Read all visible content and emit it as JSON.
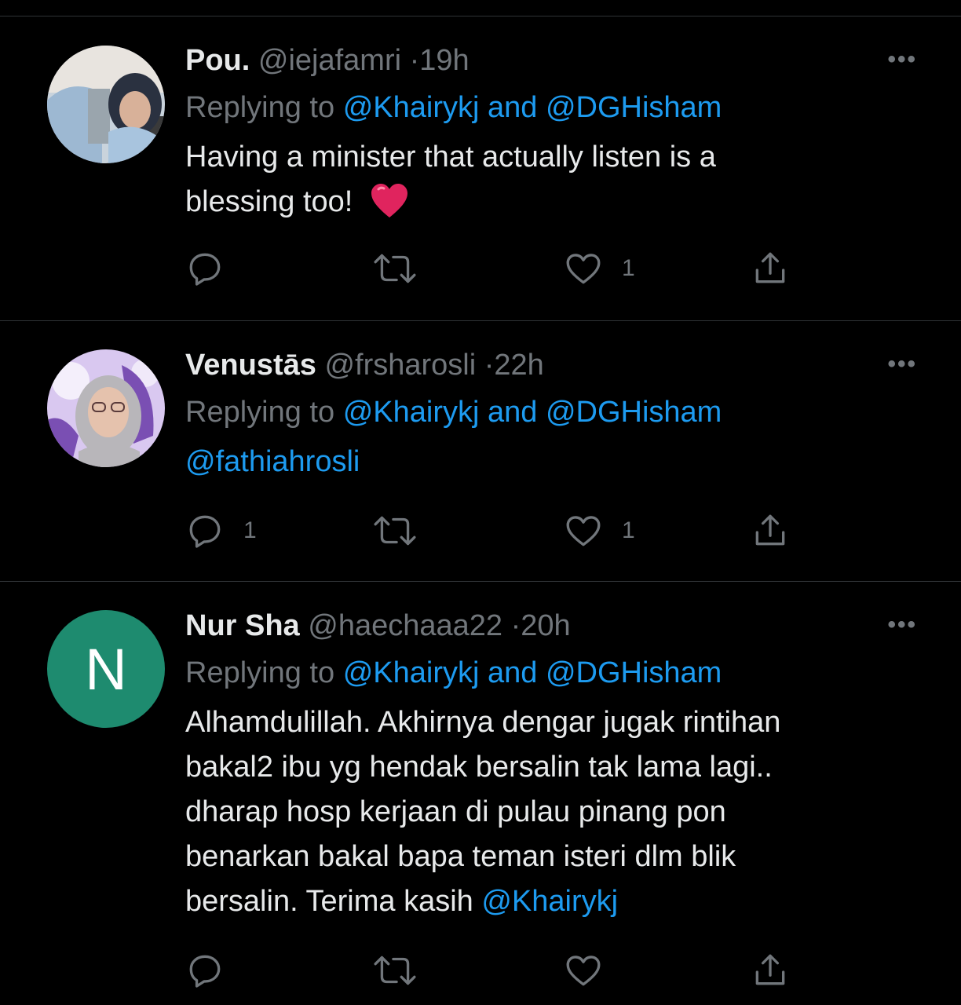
{
  "colors": {
    "background": "#000000",
    "text": "#e7e9ea",
    "secondary": "#71767b",
    "link": "#1d9bf0",
    "divider": "#2f3336",
    "heart_emoji": "#e0245e"
  },
  "tweets": [
    {
      "name": "Pou.",
      "handle": "@iejafamri",
      "separator": "·",
      "time": "19h",
      "replying_prefix": "Replying to",
      "replying_user1": "@Khairykj",
      "replying_and": "and",
      "replying_user2": "@DGHisham",
      "text_line1": "Having a minister that actually listen is a",
      "text_line2": "blessing too!",
      "emoji": "heart-emoji",
      "more_label": "•••",
      "actions": {
        "reply_count": "",
        "retweet_count": "",
        "like_count": "1"
      }
    },
    {
      "name": "Venustās",
      "handle": "@frsharosli",
      "separator": "·",
      "time": "22h",
      "replying_prefix": "Replying to",
      "replying_user1": "@Khairykj",
      "replying_and": "and",
      "replying_user2": "@DGHisham",
      "mention_text": "@fathiahrosli",
      "more_label": "•••",
      "actions": {
        "reply_count": "1",
        "retweet_count": "",
        "like_count": "1"
      }
    },
    {
      "name": "Nur Sha",
      "handle": "@haechaaa22",
      "separator": "·",
      "time": "20h",
      "avatar_letter": "N",
      "avatar_color": "#1e8b6f",
      "replying_prefix": "Replying to",
      "replying_user1": "@Khairykj",
      "replying_and": "and",
      "replying_user2": "@DGHisham",
      "text_line1": "Alhamdulillah. Akhirnya dengar jugak rintihan",
      "text_line2": "bakal2 ibu yg hendak bersalin tak lama lagi..",
      "text_line3": "dharap hosp kerjaan di pulau pinang pon",
      "text_line4": "benarkan bakal bapa teman isteri dlm blik",
      "text_line5_prefix": "bersalin. Terima kasih",
      "text_line5_mention": "@Khairykj",
      "more_label": "•••",
      "actions": {
        "reply_count": "",
        "retweet_count": "",
        "like_count": ""
      }
    }
  ]
}
